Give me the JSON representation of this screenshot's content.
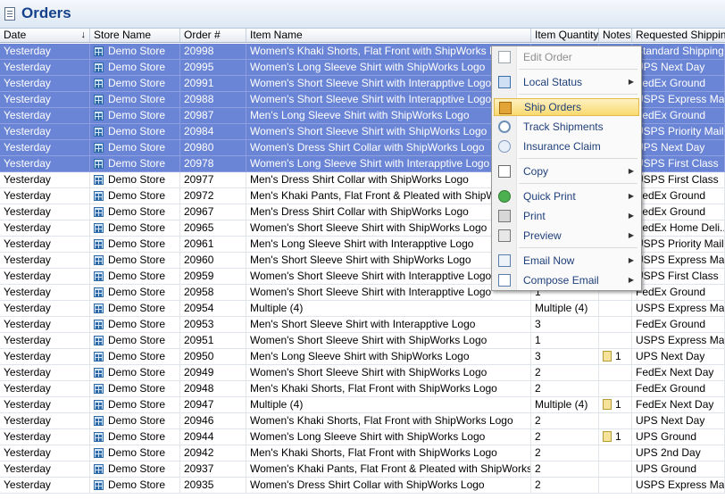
{
  "title": "Orders",
  "columns": [
    "Date",
    "Store Name",
    "Order #",
    "Item Name",
    "Item Quantity",
    "Notes",
    "Requested Shipping"
  ],
  "sort_indicator": "↓",
  "rows": [
    {
      "date": "Yesterday",
      "store": "Demo Store",
      "order": "20998",
      "item": "Women's Khaki Shorts, Flat Front with ShipWorks Logo",
      "qty": "",
      "notes": "",
      "shipping": "Standard Shipping",
      "selected": true
    },
    {
      "date": "Yesterday",
      "store": "Demo Store",
      "order": "20995",
      "item": "Women's Long Sleeve Shirt with ShipWorks Logo",
      "qty": "",
      "notes": "",
      "shipping": "UPS Next Day",
      "selected": true
    },
    {
      "date": "Yesterday",
      "store": "Demo Store",
      "order": "20991",
      "item": "Women's Short Sleeve Shirt with Interapptive Logo",
      "qty": "",
      "notes": "",
      "shipping": "FedEx Ground",
      "selected": true
    },
    {
      "date": "Yesterday",
      "store": "Demo Store",
      "order": "20988",
      "item": "Women's Short Sleeve Shirt with Interapptive Logo",
      "qty": "",
      "notes": "",
      "shipping": "USPS Express Mail",
      "selected": true
    },
    {
      "date": "Yesterday",
      "store": "Demo Store",
      "order": "20987",
      "item": "Men's Long Sleeve Shirt with ShipWorks Logo",
      "qty": "",
      "notes": "",
      "shipping": "FedEx Ground",
      "selected": true
    },
    {
      "date": "Yesterday",
      "store": "Demo Store",
      "order": "20984",
      "item": "Women's Short Sleeve Shirt with ShipWorks Logo",
      "qty": "",
      "notes": "",
      "shipping": "USPS Priority Mail",
      "selected": true
    },
    {
      "date": "Yesterday",
      "store": "Demo Store",
      "order": "20980",
      "item": "Women's Dress Shirt Collar with ShipWorks Logo",
      "qty": "",
      "notes": "",
      "shipping": "UPS Next Day",
      "selected": true
    },
    {
      "date": "Yesterday",
      "store": "Demo Store",
      "order": "20978",
      "item": "Women's Long Sleeve Shirt with Interapptive Logo",
      "qty": "",
      "notes": "",
      "shipping": "USPS First Class",
      "selected": true
    },
    {
      "date": "Yesterday",
      "store": "Demo Store",
      "order": "20977",
      "item": "Men's Dress Shirt Collar with ShipWorks Logo",
      "qty": "",
      "notes": "",
      "shipping": "USPS First Class",
      "selected": false
    },
    {
      "date": "Yesterday",
      "store": "Demo Store",
      "order": "20972",
      "item": "Men's Khaki Pants, Flat Front & Pleated with ShipWorks Logo",
      "qty": "",
      "notes": "",
      "shipping": "FedEx Ground",
      "selected": false
    },
    {
      "date": "Yesterday",
      "store": "Demo Store",
      "order": "20967",
      "item": "Men's Dress Shirt Collar with ShipWorks Logo",
      "qty": "",
      "notes": "",
      "shipping": "FedEx Ground",
      "selected": false
    },
    {
      "date": "Yesterday",
      "store": "Demo Store",
      "order": "20965",
      "item": "Women's Short Sleeve Shirt with ShipWorks Logo",
      "qty": "",
      "notes": "",
      "shipping": "FedEx Home Deli...",
      "selected": false
    },
    {
      "date": "Yesterday",
      "store": "Demo Store",
      "order": "20961",
      "item": "Men's Long Sleeve Shirt with Interapptive Logo",
      "qty": "",
      "notes": "",
      "shipping": "USPS Priority Mail",
      "selected": false
    },
    {
      "date": "Yesterday",
      "store": "Demo Store",
      "order": "20960",
      "item": "Men's Short Sleeve Shirt with ShipWorks Logo",
      "qty": "",
      "notes": "",
      "shipping": "USPS Express Mail",
      "selected": false
    },
    {
      "date": "Yesterday",
      "store": "Demo Store",
      "order": "20959",
      "item": "Women's Short Sleeve Shirt with Interapptive Logo",
      "qty": "",
      "notes": "",
      "shipping": "USPS First Class",
      "selected": false
    },
    {
      "date": "Yesterday",
      "store": "Demo Store",
      "order": "20958",
      "item": "Women's Short Sleeve Shirt with Interapptive Logo",
      "qty": "1",
      "notes": "",
      "shipping": "FedEx Ground",
      "selected": false
    },
    {
      "date": "Yesterday",
      "store": "Demo Store",
      "order": "20954",
      "item": "Multiple (4)",
      "qty": "Multiple (4)",
      "notes": "",
      "shipping": "USPS Express Mail",
      "selected": false
    },
    {
      "date": "Yesterday",
      "store": "Demo Store",
      "order": "20953",
      "item": "Men's Short Sleeve Shirt with Interapptive Logo",
      "qty": "3",
      "notes": "",
      "shipping": "FedEx Ground",
      "selected": false
    },
    {
      "date": "Yesterday",
      "store": "Demo Store",
      "order": "20951",
      "item": "Women's Short Sleeve Shirt with ShipWorks Logo",
      "qty": "1",
      "notes": "",
      "shipping": "USPS Express Mail",
      "selected": false
    },
    {
      "date": "Yesterday",
      "store": "Demo Store",
      "order": "20950",
      "item": "Men's Long Sleeve Shirt with ShipWorks Logo",
      "qty": "3",
      "notes": "1",
      "shipping": "UPS Next Day",
      "selected": false
    },
    {
      "date": "Yesterday",
      "store": "Demo Store",
      "order": "20949",
      "item": "Women's Short Sleeve Shirt with ShipWorks Logo",
      "qty": "2",
      "notes": "",
      "shipping": "FedEx Next Day",
      "selected": false
    },
    {
      "date": "Yesterday",
      "store": "Demo Store",
      "order": "20948",
      "item": "Men's Khaki Shorts, Flat Front with ShipWorks Logo",
      "qty": "2",
      "notes": "",
      "shipping": "FedEx Ground",
      "selected": false
    },
    {
      "date": "Yesterday",
      "store": "Demo Store",
      "order": "20947",
      "item": "Multiple (4)",
      "qty": "Multiple (4)",
      "notes": "1",
      "shipping": "FedEx Next Day",
      "selected": false
    },
    {
      "date": "Yesterday",
      "store": "Demo Store",
      "order": "20946",
      "item": "Women's Khaki Shorts, Flat Front with ShipWorks Logo",
      "qty": "2",
      "notes": "",
      "shipping": "UPS Next Day",
      "selected": false
    },
    {
      "date": "Yesterday",
      "store": "Demo Store",
      "order": "20944",
      "item": "Women's Long Sleeve Shirt with ShipWorks Logo",
      "qty": "2",
      "notes": "1",
      "shipping": "UPS Ground",
      "selected": false
    },
    {
      "date": "Yesterday",
      "store": "Demo Store",
      "order": "20942",
      "item": "Men's Khaki Shorts, Flat Front with ShipWorks Logo",
      "qty": "2",
      "notes": "",
      "shipping": "UPS 2nd Day",
      "selected": false
    },
    {
      "date": "Yesterday",
      "store": "Demo Store",
      "order": "20937",
      "item": "Women's Khaki Pants, Flat Front & Pleated with ShipWorks Logo",
      "qty": "2",
      "notes": "",
      "shipping": "UPS Ground",
      "selected": false
    },
    {
      "date": "Yesterday",
      "store": "Demo Store",
      "order": "20935",
      "item": "Women's Dress Shirt Collar with ShipWorks Logo",
      "qty": "2",
      "notes": "",
      "shipping": "USPS Express Mail",
      "selected": false
    }
  ],
  "context_menu": {
    "items": [
      {
        "label": "Edit Order",
        "icon": "edit-order-icon",
        "submenu": false,
        "disabled": true,
        "highlighted": false
      },
      {
        "label": "Local Status",
        "icon": "local-status-icon",
        "submenu": true,
        "disabled": false,
        "highlighted": false
      },
      {
        "label": "Ship Orders",
        "icon": "ship-orders-icon",
        "submenu": false,
        "disabled": false,
        "highlighted": true
      },
      {
        "label": "Track Shipments",
        "icon": "track-shipments-icon",
        "submenu": false,
        "disabled": false,
        "highlighted": false
      },
      {
        "label": "Insurance Claim",
        "icon": "insurance-claim-icon",
        "submenu": false,
        "disabled": false,
        "highlighted": false
      },
      {
        "label": "Copy",
        "icon": "copy-icon",
        "submenu": true,
        "disabled": false,
        "highlighted": false
      },
      {
        "label": "Quick Print",
        "icon": "quick-print-icon",
        "submenu": true,
        "disabled": false,
        "highlighted": false
      },
      {
        "label": "Print",
        "icon": "print-icon",
        "submenu": true,
        "disabled": false,
        "highlighted": false
      },
      {
        "label": "Preview",
        "icon": "preview-icon",
        "submenu": true,
        "disabled": false,
        "highlighted": false
      },
      {
        "label": "Email Now",
        "icon": "email-now-icon",
        "submenu": true,
        "disabled": false,
        "highlighted": false
      },
      {
        "label": "Compose Email",
        "icon": "compose-email-icon",
        "submenu": true,
        "disabled": false,
        "highlighted": false
      }
    ],
    "submenu_arrow": "▶"
  },
  "colors": {
    "selection": "#6b85d6",
    "title": "#15428b",
    "menu_highlight": "#f9da6f"
  }
}
